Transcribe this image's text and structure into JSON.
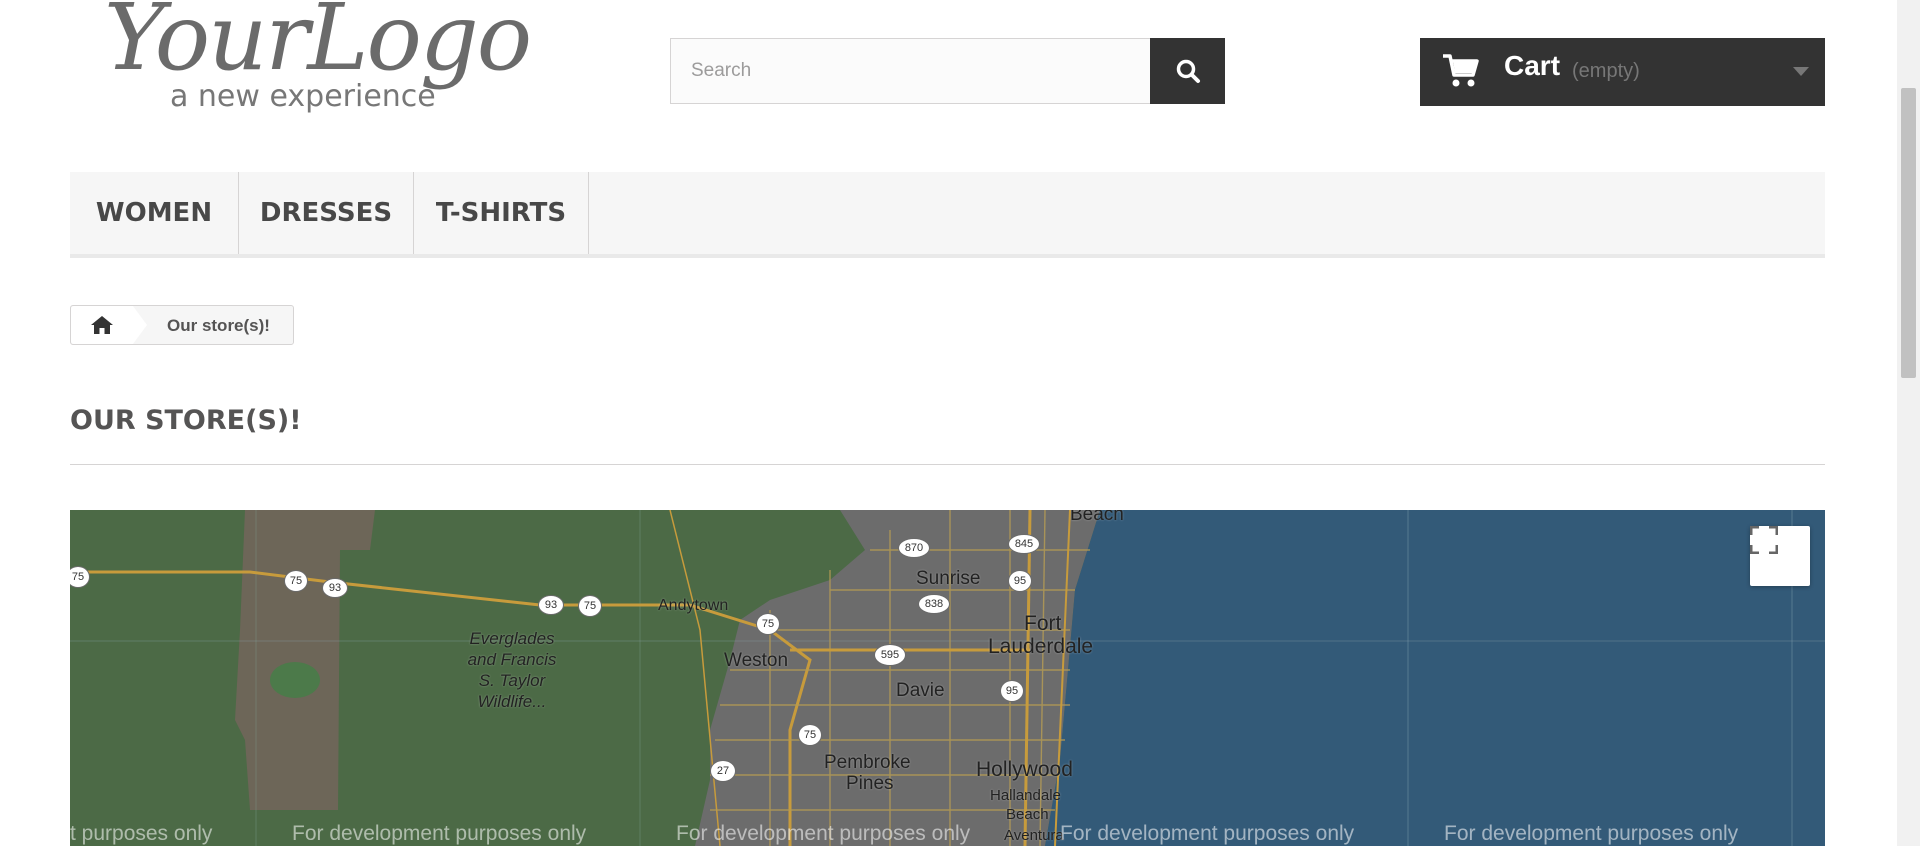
{
  "logo": {
    "main": "YourLogo",
    "tagline": "a new experience"
  },
  "search": {
    "placeholder": "Search",
    "icon": "search-icon"
  },
  "cart": {
    "label": "Cart",
    "status": "(empty)",
    "icon": "cart-icon"
  },
  "nav": {
    "items": [
      {
        "label": "WOMEN"
      },
      {
        "label": "DRESSES"
      },
      {
        "label": "T-SHIRTS"
      }
    ]
  },
  "breadcrumb": {
    "home_icon": "home-icon",
    "current": "Our store(s)!"
  },
  "page": {
    "title": "OUR STORE(S)!"
  },
  "map": {
    "labels": {
      "andytown": "Andytown",
      "weston": "Weston",
      "sunrise": "Sunrise",
      "davie": "Davie",
      "fort_lauderdale_1": "Fort",
      "fort_lauderdale_2": "Lauderdale",
      "hollywood": "Hollywood",
      "pembroke_1": "Pembroke",
      "pembroke_2": "Pines",
      "hallandale_1": "Hallandale",
      "hallandale_2": "Beach",
      "aventura": "Aventura",
      "beach_top": "Beach",
      "everglades_1": "Everglades",
      "everglades_2": "and Francis",
      "everglades_3": "S. Taylor",
      "everglades_4": "Wildlife..."
    },
    "shields": {
      "s75a": "75",
      "s75b": "75",
      "s93a": "93",
      "s93b": "93",
      "s75c": "75",
      "s870": "870",
      "s845": "845",
      "s95a": "95",
      "s838": "838",
      "s75d": "75",
      "s595": "595",
      "s95b": "95",
      "s75e": "75",
      "s27": "27"
    },
    "watermark": {
      "w1": "t purposes only",
      "w2": "For development purposes only",
      "w3": "For development purposes only",
      "w4": "For development purposes only",
      "w5": "For development purposes only"
    },
    "fullscreen_icon": "fullscreen-icon",
    "colors": {
      "land": "#4c6a46",
      "water": "#335a78",
      "urban": "#6c6c6c",
      "roads": "#c79b3c"
    }
  }
}
